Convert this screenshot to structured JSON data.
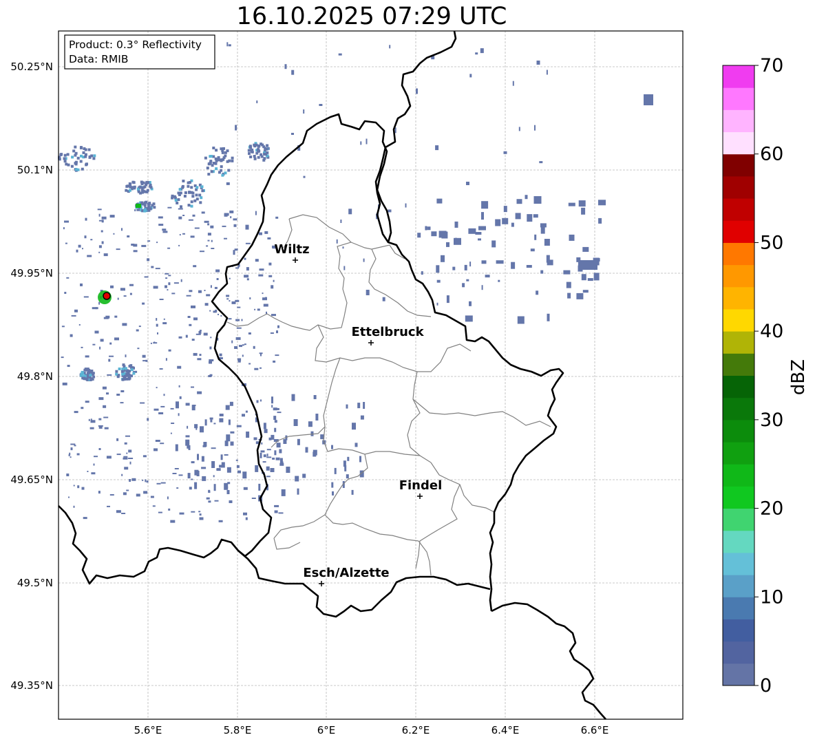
{
  "title": "16.10.2025 07:29 UTC",
  "info_box": {
    "line1": "Product: 0.3° Reflectivity",
    "line2": "Data: RMIB"
  },
  "axes": {
    "lon_ticks": [
      "5.6°E",
      "5.8°E",
      "6°E",
      "6.2°E",
      "6.4°E",
      "6.6°E"
    ],
    "lat_ticks": [
      "50.25°N",
      "50.1°N",
      "49.95°N",
      "49.8°N",
      "49.65°N",
      "49.5°N",
      "49.35°N"
    ]
  },
  "cities": [
    {
      "name": "Wiltz"
    },
    {
      "name": "Ettelbruck"
    },
    {
      "name": "Findel"
    },
    {
      "name": "Esch/Alzette"
    }
  ],
  "colorbar": {
    "label": "dBZ",
    "ticks": [
      "0",
      "10",
      "20",
      "30",
      "40",
      "50",
      "60",
      "70"
    ],
    "colors": [
      "#6474a6",
      "#5264a0",
      "#425ea0",
      "#4a7ab0",
      "#5aa0c8",
      "#64c0d8",
      "#64d8c0",
      "#40d470",
      "#10c820",
      "#10b818",
      "#10a010",
      "#0c8c0c",
      "#0a780a",
      "#066406",
      "#447a0a",
      "#b0b406",
      "#ffd800",
      "#ffb400",
      "#ff9800",
      "#ff7800",
      "#e00000",
      "#c00000",
      "#a00000",
      "#800000",
      "#ffe0ff",
      "#ffb4ff",
      "#ff78ff",
      "#f03cf0"
    ]
  },
  "colors": {
    "echo_weak": "#6476aa",
    "echo_mid": "#5ab4d4",
    "echo_green": "#10b818",
    "marker": "#e00000"
  }
}
